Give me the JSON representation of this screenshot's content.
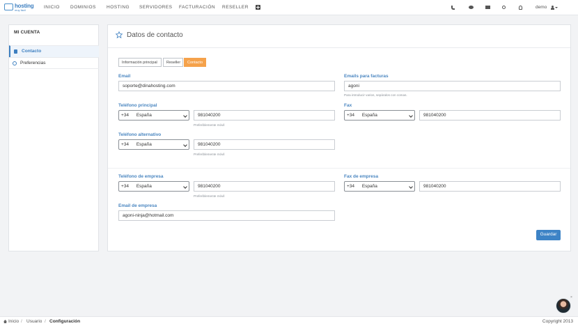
{
  "app": {
    "logo_line1": "hosting",
    "logo_line2": "muy fácil"
  },
  "nav": {
    "items": [
      "INICIO",
      "DOMINIOS",
      "HOSTING",
      "SERVIDORES",
      "FACTURACIÓN",
      "RESELLER"
    ],
    "user": "demo",
    "icons": [
      "phone-icon",
      "chat-icon",
      "mail-icon",
      "search-icon",
      "bell-icon",
      "user-icon"
    ]
  },
  "sidebar": {
    "title": "MI CUENTA",
    "items": [
      {
        "label": "Contacto",
        "icon": "address-card-icon",
        "active": true
      },
      {
        "label": "Preferencias",
        "icon": "gear-icon",
        "active": false
      }
    ]
  },
  "panel": {
    "title": "Datos de contacto",
    "tabs": [
      {
        "label": "Información principal",
        "active": false
      },
      {
        "label": "Reseller",
        "active": false
      },
      {
        "label": "Contacto",
        "active": true
      }
    ]
  },
  "form": {
    "email": {
      "label": "Email",
      "value": "soporte@dinahosting.com"
    },
    "emails_facturas": {
      "label": "Emails para facturas",
      "value": "agoni",
      "help": "Para introducir varios, sepáralos con comas."
    },
    "telefono_principal": {
      "label": "Teléfono principal",
      "prefix": "+34",
      "country": "España",
      "value": "981040200",
      "help": "Preferiblemente móvil"
    },
    "fax": {
      "label": "Fax",
      "prefix": "+34",
      "country": "España",
      "value": "981040200"
    },
    "telefono_alternativo": {
      "label": "Teléfono alternativo",
      "prefix": "+34",
      "country": "España",
      "value": "981040200",
      "help": "Preferiblemente móvil"
    },
    "telefono_empresa": {
      "label": "Teléfono de empresa",
      "prefix": "+34",
      "country": "España",
      "value": "981040200",
      "help": "Preferiblemente móvil"
    },
    "fax_empresa": {
      "label": "Fax de empresa",
      "prefix": "+34",
      "country": "España",
      "value": "981040200"
    },
    "email_empresa": {
      "label": "Email de empresa",
      "value": "agoni-ninja@hotmail.com"
    },
    "save_label": "Guardar"
  },
  "footer": {
    "breadcrumb": [
      "Inicio",
      "Usuario",
      "Configuración"
    ],
    "copyright": "Copyright 2013"
  },
  "chat_widget": {
    "close_label": "×"
  },
  "colors": {
    "accent": "#3d7fc0",
    "tab_active": "#f5a24b",
    "save_button": "#3d83c6"
  }
}
